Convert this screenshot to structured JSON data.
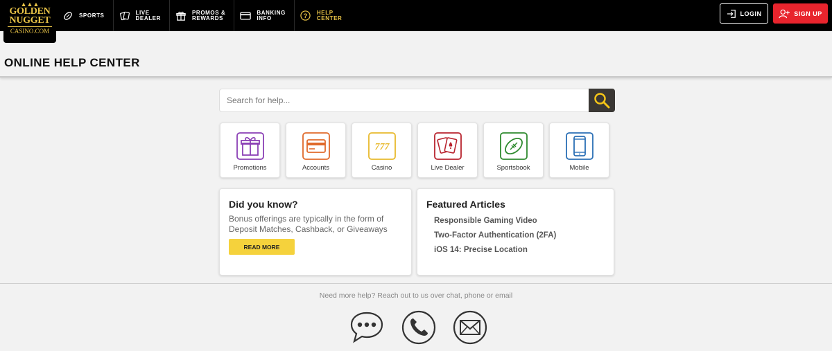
{
  "logo": {
    "line1": "GOLDEN",
    "line2": "NUGGET",
    "line3": "CASINO.COM"
  },
  "nav": [
    {
      "label": "SPORTS",
      "icon": "football-icon",
      "active": false
    },
    {
      "label": "LIVE\nDEALER",
      "icon": "cards-icon",
      "active": false
    },
    {
      "label": "PROMOS &\nREWARDS",
      "icon": "gift-icon",
      "active": false
    },
    {
      "label": "BANKING\nINFO",
      "icon": "card-icon",
      "active": false
    },
    {
      "label": "HELP\nCENTER",
      "icon": "help-icon",
      "active": true
    }
  ],
  "header": {
    "login_label": "LOGIN",
    "signup_label": "SIGN UP"
  },
  "page": {
    "title": "ONLINE HELP CENTER"
  },
  "search": {
    "placeholder": "Search for help..."
  },
  "categories": [
    {
      "label": "Promotions",
      "icon": "gift-icon",
      "color": "#8a3fb5"
    },
    {
      "label": "Accounts",
      "icon": "credit-card-icon",
      "color": "#e06a2b"
    },
    {
      "label": "Casino",
      "icon": "slot-777-icon",
      "color": "#e8b92c"
    },
    {
      "label": "Live Dealer",
      "icon": "playing-cards-icon",
      "color": "#b8232e"
    },
    {
      "label": "Sportsbook",
      "icon": "football-icon",
      "color": "#2f8a2f"
    },
    {
      "label": "Mobile",
      "icon": "mobile-phone-icon",
      "color": "#2a6fb5"
    }
  ],
  "did_you_know": {
    "title": "Did you know?",
    "text": "Bonus offerings are typically in the form of Deposit Matches, Cashback, or Giveaways",
    "button": "READ MORE"
  },
  "featured": {
    "title": "Featured Articles",
    "articles": [
      "Responsible Gaming Video",
      "Two-Factor Authentication (2FA)",
      "iOS 14: Precise Location"
    ]
  },
  "footer": {
    "help_text": "Need more help? Reach out to us over chat, phone or email",
    "contacts": [
      "chat-icon",
      "phone-icon",
      "email-icon"
    ]
  },
  "colors": {
    "accent_gold": "#e8c347",
    "signup_red": "#e8242d",
    "button_yellow": "#f5d23c"
  }
}
